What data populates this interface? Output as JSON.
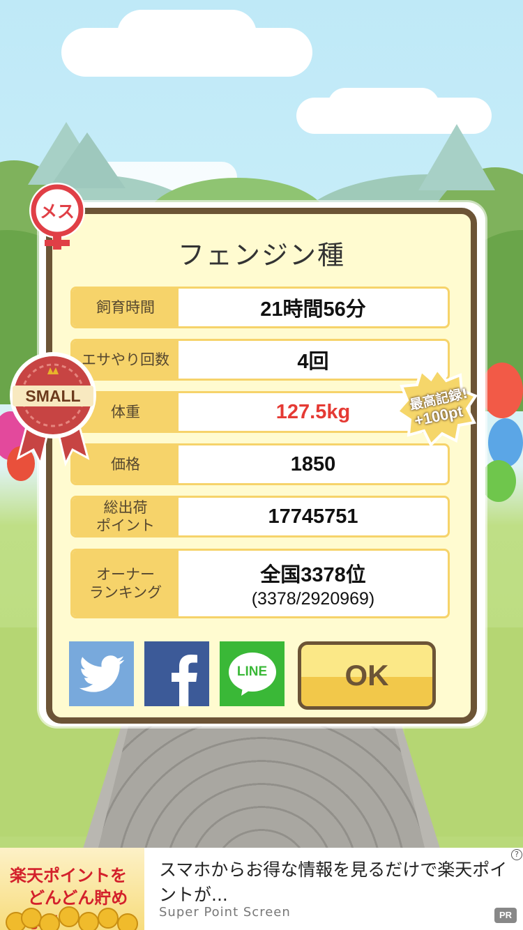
{
  "dialog": {
    "title": "フェンジン種",
    "rows": [
      {
        "label": "飼育時間",
        "value": "21時間56分"
      },
      {
        "label": "エサやり回数",
        "value": "4回"
      },
      {
        "label": "体重",
        "value": "127.5kg"
      },
      {
        "label": "価格",
        "value": "1850"
      },
      {
        "label": "総出荷\nポイント",
        "value": "17745751"
      },
      {
        "label": "オーナー\nランキング",
        "value": "全国3378位",
        "sub": "(3378/2920969)"
      }
    ],
    "ok_label": "OK",
    "share": {
      "line_label": "LINE"
    }
  },
  "badges": {
    "gender": "メス",
    "size": "SMALL",
    "record_line1": "最高記録!",
    "record_line2": "+100pt"
  },
  "ad": {
    "image_line1": "楽天ポイントを",
    "image_line2": "どんどん貯めよう",
    "headline": "スマホからお得な情報を見るだけで楽天ポイントが...",
    "source": "Super Point Screen",
    "pr_label": "PR",
    "info_icon": "?"
  },
  "colors": {
    "dialog_bg": "#fffbd0",
    "frame": "#6c5436",
    "label_bg": "#f6d36a",
    "weight_value": "#e53a34",
    "twitter": "#78a9dc",
    "facebook": "#3c5a98",
    "line": "#3ab837"
  }
}
